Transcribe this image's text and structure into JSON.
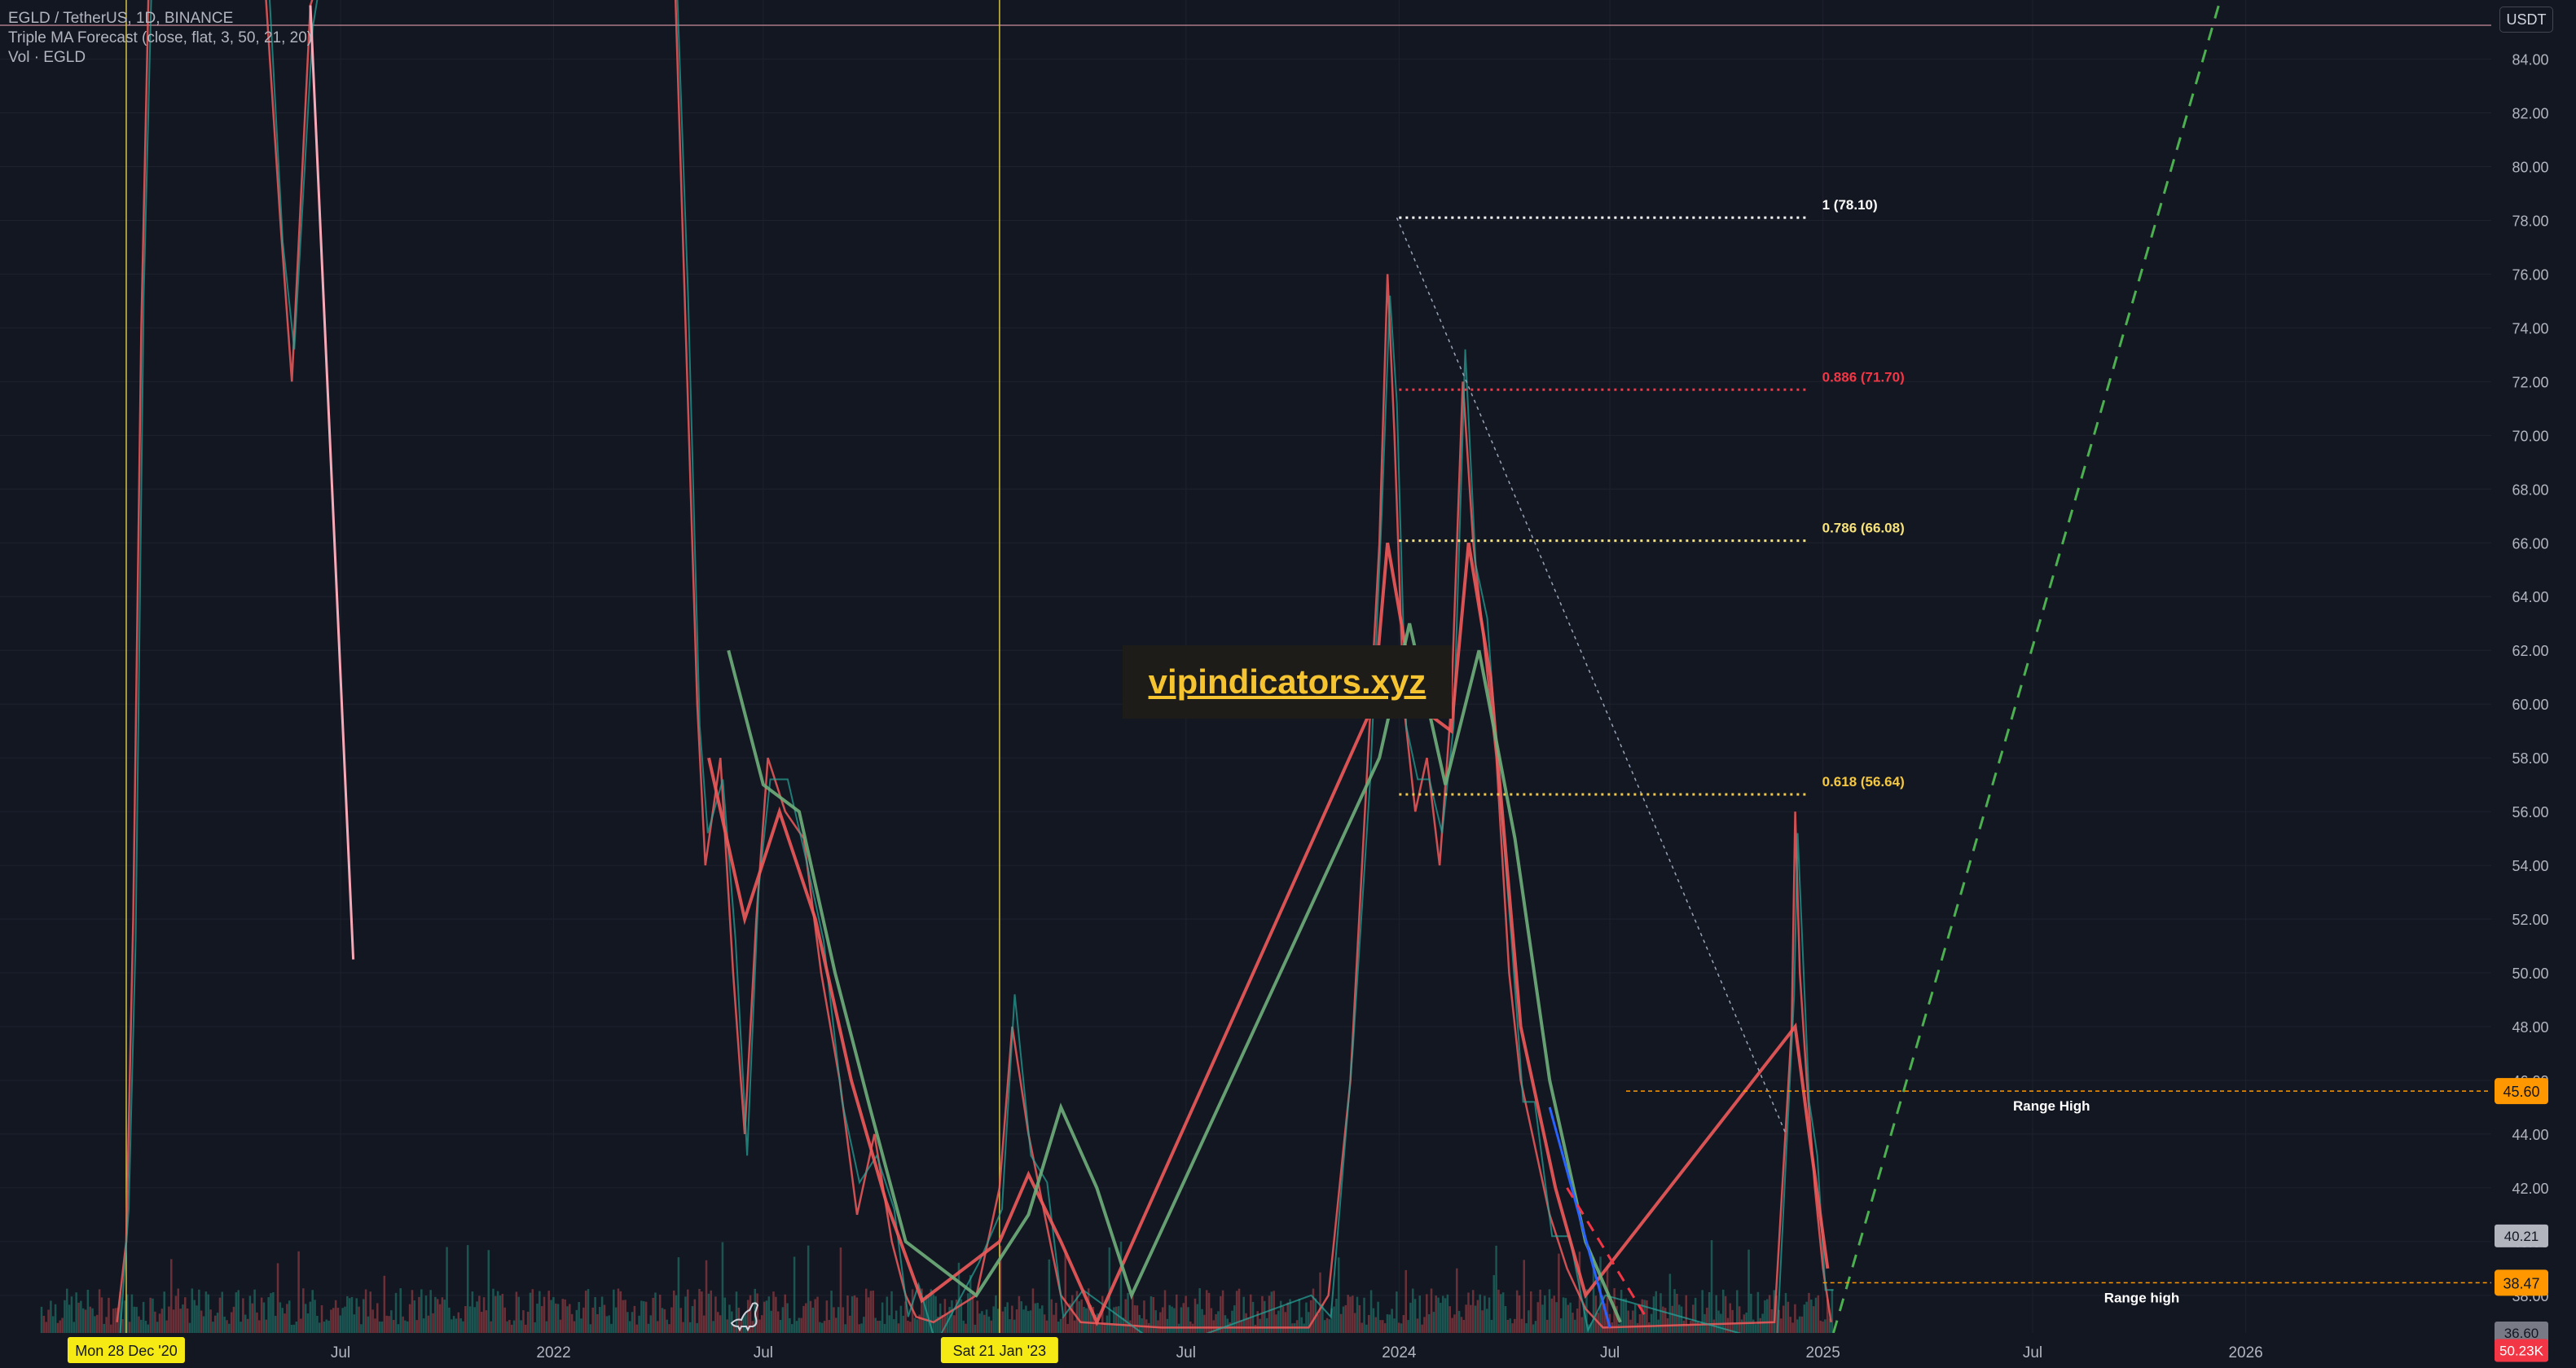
{
  "header": {
    "symbol_line": "EGLD / TetherUS, 1D, BINANCE",
    "indicator_line": "Triple MA Forecast (close, flat, 3, 50, 21, 20)",
    "volume_line": "Vol · EGLD",
    "currency_button": "USDT"
  },
  "watermark": {
    "text": "vipindicators.xyz"
  },
  "colors": {
    "background": "#131722",
    "grid": "#1e222d",
    "up": "#26a69a",
    "down": "#f05a5a",
    "ma_fast": "#f05a5a",
    "ma_slow": "#6fae7b",
    "fib_100": "#ffffff",
    "fib_886": "#f23645",
    "fib_786": "#f7e27a",
    "fib_618": "#f5c842",
    "range_line": "#ff9800",
    "projection": "#4caf50",
    "marker_line": "#d4c24a",
    "date_badge": "#f5ea14"
  },
  "chart_data": {
    "type": "line",
    "title": "EGLD / TetherUS, 1D, BINANCE",
    "ylim": [
      36.6,
      86.2
    ],
    "x_range": [
      "2020-09-10",
      "2026-08-01"
    ],
    "y_ticks": [
      "84.00",
      "82.00",
      "80.00",
      "78.00",
      "76.00",
      "74.00",
      "72.00",
      "70.00",
      "68.00",
      "66.00",
      "64.00",
      "62.00",
      "60.00",
      "58.00",
      "56.00",
      "54.00",
      "52.00",
      "50.00",
      "48.00",
      "46.00",
      "44.00",
      "42.00",
      "40.00",
      "38.00"
    ],
    "x_ticks": [
      {
        "label": "Jul",
        "date": "2021-07-01"
      },
      {
        "label": "2022",
        "date": "2022-01-01"
      },
      {
        "label": "Jul",
        "date": "2022-07-01"
      },
      {
        "label": "Jul",
        "date": "2023-07-01"
      },
      {
        "label": "2024",
        "date": "2024-01-01"
      },
      {
        "label": "Jul",
        "date": "2024-07-01"
      },
      {
        "label": "2025",
        "date": "2025-01-01"
      },
      {
        "label": "Jul",
        "date": "2025-07-01"
      },
      {
        "label": "2026",
        "date": "2026-01-01"
      }
    ],
    "date_badges": [
      {
        "label": "Mon 28 Dec '20",
        "date": "2020-12-28"
      },
      {
        "label": "Sat 21 Jan '23",
        "date": "2023-01-21"
      }
    ],
    "fib_levels": [
      {
        "label": "1 (78.10)",
        "value": 78.1,
        "from": "2024-01-01",
        "to": "2024-12-20"
      },
      {
        "label": "0.886 (71.70)",
        "value": 71.7,
        "from": "2024-01-01",
        "to": "2024-12-20"
      },
      {
        "label": "0.786 (66.08)",
        "value": 66.08,
        "from": "2024-01-01",
        "to": "2024-12-20"
      },
      {
        "label": "0.618 (56.64)",
        "value": 56.64,
        "from": "2024-01-01",
        "to": "2024-12-20"
      }
    ],
    "range_levels": [
      {
        "label": "Range High",
        "value": 45.6,
        "price_label": "45.60",
        "from": "2024-07-15"
      },
      {
        "label": "Range high",
        "value": 38.47,
        "price_label": "38.47",
        "from": "2025-01-01"
      }
    ],
    "price_badges": [
      {
        "label": "40.21",
        "value": 40.21
      },
      {
        "label": "36.60",
        "value": 36.6
      },
      {
        "label": "50.23K",
        "value": 35.95
      }
    ],
    "series": [
      {
        "name": "EGLD",
        "values": [
          [
            "2020-12-20",
            37.0
          ],
          [
            "2020-12-28",
            40.0
          ],
          [
            "2021-01-03",
            52.0
          ],
          [
            "2021-01-10",
            74.0
          ],
          [
            "2021-01-17",
            88.0
          ],
          [
            "2021-04-25",
            88.0
          ],
          [
            "2021-05-10",
            78.0
          ],
          [
            "2021-05-20",
            72.0
          ],
          [
            "2021-06-05",
            86.0
          ],
          [
            "2021-06-20",
            88.0
          ],
          [
            "2022-04-15",
            88.0
          ],
          [
            "2022-04-25",
            74.0
          ],
          [
            "2022-05-05",
            60.0
          ],
          [
            "2022-05-12",
            54.0
          ],
          [
            "2022-05-25",
            58.0
          ],
          [
            "2022-06-05",
            50.0
          ],
          [
            "2022-06-15",
            44.0
          ],
          [
            "2022-06-25",
            52.0
          ],
          [
            "2022-07-05",
            58.0
          ],
          [
            "2022-07-20",
            56.0
          ],
          [
            "2022-08-05",
            55.0
          ],
          [
            "2022-08-20",
            50.0
          ],
          [
            "2022-09-05",
            46.0
          ],
          [
            "2022-09-20",
            41.0
          ],
          [
            "2022-10-05",
            44.0
          ],
          [
            "2022-10-20",
            40.0
          ],
          [
            "2022-11-01",
            38.0
          ],
          [
            "2022-11-10",
            37.2
          ],
          [
            "2022-11-25",
            37.0
          ],
          [
            "2023-01-01",
            38.0
          ],
          [
            "2023-01-21",
            42.0
          ],
          [
            "2023-02-01",
            48.0
          ],
          [
            "2023-02-15",
            44.0
          ],
          [
            "2023-03-01",
            41.0
          ],
          [
            "2023-03-15",
            38.0
          ],
          [
            "2023-04-01",
            37.0
          ],
          [
            "2023-06-10",
            36.8
          ],
          [
            "2023-10-15",
            36.8
          ],
          [
            "2023-11-01",
            38.0
          ],
          [
            "2023-11-20",
            46.0
          ],
          [
            "2023-12-05",
            58.0
          ],
          [
            "2023-12-15",
            66.0
          ],
          [
            "2023-12-22",
            76.0
          ],
          [
            "2023-12-28",
            70.0
          ],
          [
            "2024-01-05",
            60.0
          ],
          [
            "2024-01-15",
            56.0
          ],
          [
            "2024-01-25",
            58.0
          ],
          [
            "2024-02-05",
            54.0
          ],
          [
            "2024-02-15",
            60.0
          ],
          [
            "2024-02-25",
            72.0
          ],
          [
            "2024-03-05",
            66.0
          ],
          [
            "2024-03-15",
            62.0
          ],
          [
            "2024-03-25",
            58.0
          ],
          [
            "2024-04-05",
            50.0
          ],
          [
            "2024-04-15",
            46.0
          ],
          [
            "2024-04-25",
            44.0
          ],
          [
            "2024-05-10",
            41.0
          ],
          [
            "2024-05-25",
            39.0
          ],
          [
            "2024-06-10",
            37.5
          ],
          [
            "2024-06-25",
            36.8
          ],
          [
            "2024-11-20",
            37.0
          ],
          [
            "2024-12-05",
            48.0
          ],
          [
            "2024-12-08",
            56.0
          ],
          [
            "2024-12-12",
            50.0
          ],
          [
            "2024-12-18",
            46.0
          ],
          [
            "2024-12-25",
            42.0
          ],
          [
            "2025-01-01",
            39.0
          ],
          [
            "2025-01-08",
            37.0
          ]
        ]
      },
      {
        "name": "MA fast",
        "values": [
          [
            "2022-05-15",
            58.0
          ],
          [
            "2022-06-15",
            52.0
          ],
          [
            "2022-07-15",
            56.0
          ],
          [
            "2022-08-15",
            52.0
          ],
          [
            "2022-09-15",
            46.0
          ],
          [
            "2022-10-15",
            41.5
          ],
          [
            "2022-11-15",
            37.8
          ],
          [
            "2023-01-21",
            40.0
          ],
          [
            "2023-02-15",
            42.5
          ],
          [
            "2023-03-15",
            40.0
          ],
          [
            "2023-04-15",
            37.0
          ],
          [
            "2023-12-10",
            60.0
          ],
          [
            "2023-12-22",
            66.0
          ],
          [
            "2024-01-15",
            60.0
          ],
          [
            "2024-02-15",
            59.0
          ],
          [
            "2024-03-01",
            66.0
          ],
          [
            "2024-03-20",
            61.0
          ],
          [
            "2024-04-15",
            48.0
          ],
          [
            "2024-05-15",
            42.0
          ],
          [
            "2024-06-10",
            38.0
          ],
          [
            "2024-12-08",
            48.0
          ],
          [
            "2024-12-20",
            44.0
          ],
          [
            "2025-01-05",
            39.0
          ]
        ]
      },
      {
        "name": "MA slow",
        "values": [
          [
            "2022-06-01",
            62.0
          ],
          [
            "2022-07-01",
            57.0
          ],
          [
            "2022-08-01",
            56.0
          ],
          [
            "2022-09-01",
            50.0
          ],
          [
            "2022-10-01",
            45.0
          ],
          [
            "2022-11-01",
            40.0
          ],
          [
            "2023-01-01",
            38.0
          ],
          [
            "2023-02-15",
            41.0
          ],
          [
            "2023-03-15",
            45.0
          ],
          [
            "2023-04-15",
            42.0
          ],
          [
            "2023-05-15",
            38.0
          ],
          [
            "2023-12-15",
            58.0
          ],
          [
            "2024-01-10",
            63.0
          ],
          [
            "2024-02-10",
            57.0
          ],
          [
            "2024-03-10",
            62.0
          ],
          [
            "2024-04-10",
            55.0
          ],
          [
            "2024-05-10",
            46.0
          ],
          [
            "2024-06-10",
            40.0
          ],
          [
            "2024-07-10",
            37.0
          ]
        ]
      }
    ],
    "projection": {
      "name": "forecast",
      "values": [
        [
          "2025-01-10",
          36.6
        ],
        [
          "2025-12-10",
          86.2
        ]
      ]
    },
    "trendlines": [
      {
        "name": "blue",
        "values": [
          [
            "2024-05-10",
            45.0
          ],
          [
            "2024-07-01",
            36.8
          ]
        ]
      },
      {
        "name": "red dashed",
        "values": [
          [
            "2024-05-25",
            42.0
          ],
          [
            "2024-08-01",
            37.2
          ]
        ]
      },
      {
        "name": "thin",
        "values": [
          [
            "2023-12-30",
            78.1
          ],
          [
            "2024-11-30",
            44.0
          ]
        ]
      }
    ],
    "vertical_markers": [
      "2020-12-28",
      "2023-01-21"
    ],
    "volume_label": "50.23K"
  }
}
